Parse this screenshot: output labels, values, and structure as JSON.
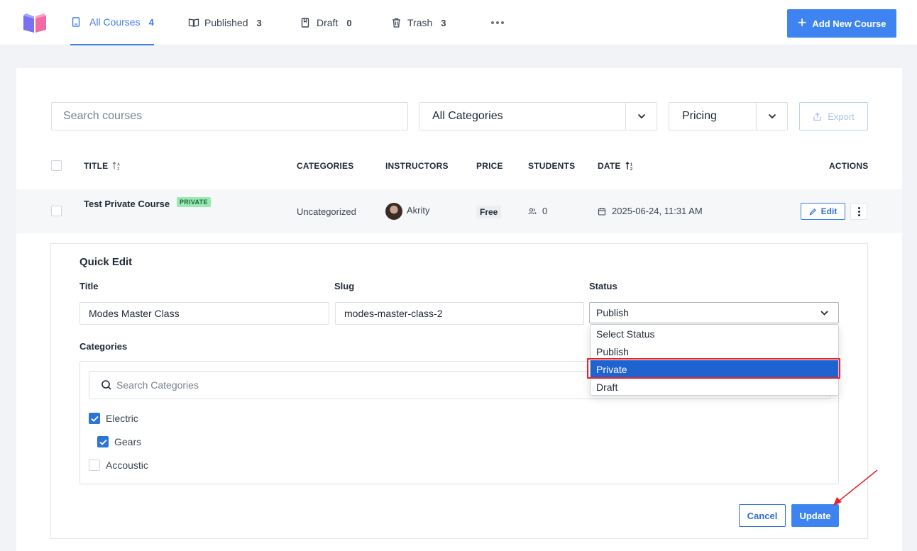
{
  "nav": {
    "tabs": [
      {
        "label": "All Courses",
        "count": "4"
      },
      {
        "label": "Published",
        "count": "3"
      },
      {
        "label": "Draft",
        "count": "0"
      },
      {
        "label": "Trash",
        "count": "3"
      }
    ],
    "add_button": "Add New Course"
  },
  "filters": {
    "search_placeholder": "Search courses",
    "category": "All Categories",
    "pricing": "Pricing",
    "export": "Export"
  },
  "table": {
    "headers": {
      "title": "TITLE",
      "categories": "CATEGORIES",
      "instructors": "INSTRUCTORS",
      "price": "PRICE",
      "students": "STUDENTS",
      "date": "DATE",
      "actions": "ACTIONS"
    },
    "rows": [
      {
        "title": "Test Private Course",
        "badge": "PRIVATE",
        "category": "Uncategorized",
        "instructor": "Akrity",
        "price": "Free",
        "students": "0",
        "date": "2025-06-24, 11:31 AM",
        "edit": "Edit"
      }
    ]
  },
  "quick_edit": {
    "heading": "Quick Edit",
    "title_label": "Title",
    "title_value": "Modes Master Class",
    "slug_label": "Slug",
    "slug_value": "modes-master-class-2",
    "status_label": "Status",
    "status_value": "Publish",
    "status_options": [
      "Select Status",
      "Publish",
      "Private",
      "Draft"
    ],
    "highlighted_option": "Private",
    "categories_label": "Categories",
    "categories_search_placeholder": "Search Categories",
    "categories": [
      {
        "name": "Electric",
        "checked": true
      },
      {
        "name": "Gears",
        "checked": true
      },
      {
        "name": "Accoustic",
        "checked": false
      }
    ],
    "cancel": "Cancel",
    "update": "Update"
  },
  "colors": {
    "accent": "#3e84f0",
    "highlight": "#1f63d1",
    "annotation_red": "#e3252b",
    "badge_green": "#9be8b4"
  }
}
